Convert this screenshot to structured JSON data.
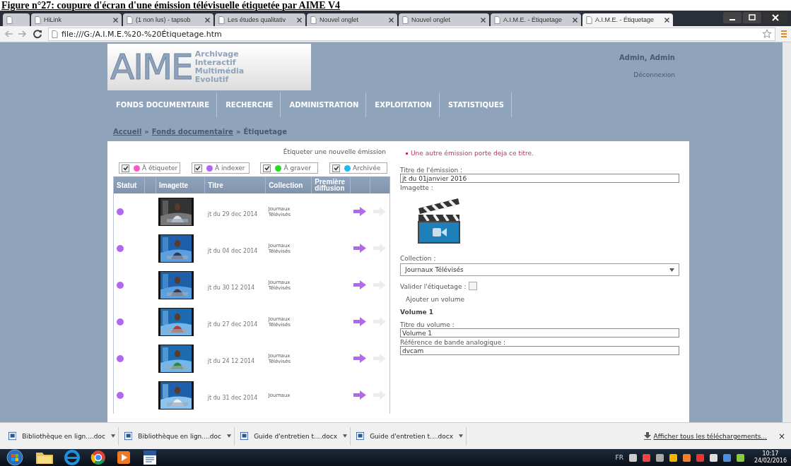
{
  "caption": "Figure n°27: coupure d'écran d'une émission télévisuelle étiquetée par AIME V4",
  "tabs": [
    {
      "selected": false
    },
    {
      "label": "HiLink",
      "selected": false
    },
    {
      "label": "(1 non lus) - tapsob",
      "selected": false
    },
    {
      "label": "Les études qualitativ",
      "selected": false
    },
    {
      "label": "Nouvel onglet",
      "selected": false
    },
    {
      "label": "Nouvel onglet",
      "selected": false
    },
    {
      "label": "A.I.M.E. - Étiquetage",
      "selected": false
    },
    {
      "label": "A.I.M.E. - Étiquetage",
      "selected": true
    }
  ],
  "address": "file:///G:/A.I.M.E.%20-%20Étiquetage.htm",
  "logo": {
    "mark": "AIME",
    "words": [
      "Archivage",
      "Interactif",
      "Multimédia",
      "Evolutif"
    ]
  },
  "user": {
    "name": "Admin, Admin",
    "logout": "Déconnexion"
  },
  "nav": [
    "FONDS DOCUMENTAIRE",
    "RECHERCHE",
    "ADMINISTRATION",
    "EXPLOITATION",
    "STATISTIQUES"
  ],
  "breadcrumb": {
    "separator": "»",
    "items": [
      {
        "label": "Accueil",
        "link": true
      },
      {
        "label": "Fonds documentaire",
        "link": true
      },
      {
        "label": "Étiquetage",
        "link": false
      }
    ]
  },
  "list_title": "Étiqueter une nouvelle émission",
  "filters": [
    {
      "label": "À étiqueter",
      "checked": true,
      "color": "#ff55cc"
    },
    {
      "label": "À indexer",
      "checked": true,
      "color": "#b366f0"
    },
    {
      "label": "À graver",
      "checked": true,
      "color": "#22dd22"
    },
    {
      "label": "Archivée",
      "checked": true,
      "color": "#22bbee"
    }
  ],
  "table": {
    "columns": [
      "Statut",
      "",
      "Imagette",
      "Titre",
      "Collection",
      "Première diffusion",
      "",
      ""
    ],
    "rows": [
      {
        "color": "#b366f0",
        "title": "jt du 29 dec 2014",
        "collection": "Journaux Télévisés"
      },
      {
        "color": "#b366f0",
        "title": "jt du 04 dec 2014",
        "collection": "Journaux Télévisés"
      },
      {
        "color": "#b366f0",
        "title": "jt du 30 12 2014",
        "collection": "Journaux Télévisés"
      },
      {
        "color": "#b366f0",
        "title": "jt du 27 dec 2014",
        "collection": "Journaux Télévisés"
      },
      {
        "color": "#b366f0",
        "title": "jt du 24 12 2014",
        "collection": "Journaux Télévisés"
      },
      {
        "color": "#b366f0",
        "title": "jt du 31 dec 2014",
        "collection": "Journaux"
      }
    ]
  },
  "form": {
    "error": "Une autre émission porte deja ce titre.",
    "title_label": "Titre de l'émission :",
    "title_value": "jt du 01janvier 2016",
    "thumb_label": "Imagette :",
    "collection_label": "Collection :",
    "collection_value": "Journaux Télévisés",
    "validate_label": "Valider l'étiquetage :",
    "validate_checked": false,
    "add_volume": "Ajouter un volume",
    "volume_heading": "Volume 1",
    "volume_title_label": "Titre du volume :",
    "volume_title_value": "Volume 1",
    "reference_label": "Référence de bande analogique :",
    "reference_value": "dvcam"
  },
  "downloads": [
    "Bibliothèque en lign....doc",
    "Bibliothèque en lign....doc",
    "Guide d'entretien t....docx",
    "Guide d'entretien t....docx"
  ],
  "downloads_link": "Afficher tous les téléchargements...",
  "downloads_close": "×",
  "taskbar": {
    "lang": "FR",
    "time": "10:17",
    "date": "24/02/2016"
  }
}
